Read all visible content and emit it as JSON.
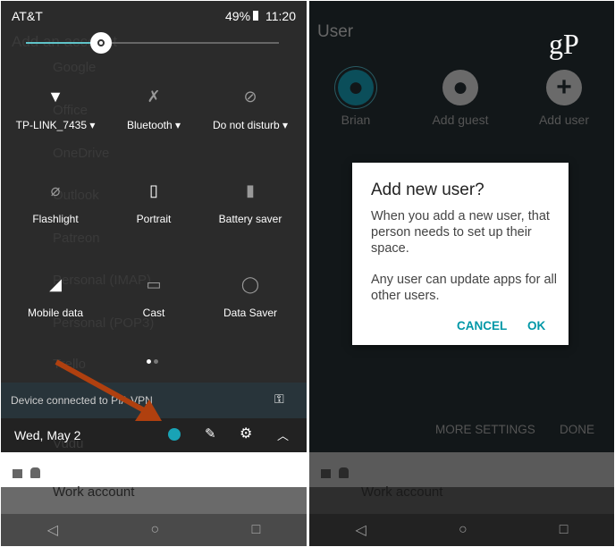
{
  "left": {
    "status": {
      "carrier": "AT&T",
      "battery": "49%",
      "time": "11:20"
    },
    "brightness_level": 0.3,
    "background_list": [
      "Add an account",
      "Google",
      "Office",
      "OneDrive",
      "Outlook",
      "Patreon",
      "Personal (IMAP)",
      "Personal (POP3)",
      "Trello",
      "Vudu",
      "Work account"
    ],
    "tiles": [
      {
        "label": "TP-LINK_7435",
        "icon": "wifi-icon",
        "dropdown": true
      },
      {
        "label": "Bluetooth",
        "icon": "bluetooth-off-icon",
        "dropdown": true
      },
      {
        "label": "Do not disturb",
        "icon": "do-not-disturb-off-icon",
        "dropdown": true
      },
      {
        "label": "Flashlight",
        "icon": "flashlight-off-icon"
      },
      {
        "label": "Portrait",
        "icon": "portrait-icon"
      },
      {
        "label": "Battery saver",
        "icon": "battery-saver-icon"
      },
      {
        "label": "Mobile data",
        "icon": "mobile-data-icon"
      },
      {
        "label": "Cast",
        "icon": "cast-icon"
      },
      {
        "label": "Data Saver",
        "icon": "data-saver-icon"
      }
    ],
    "vpn_text": "Device connected to PIA VPN",
    "date": "Wed, May 2",
    "accent": "#19a3b5",
    "arrow_color": "#b0400f"
  },
  "right": {
    "title": "User",
    "logo": "gP",
    "users": [
      {
        "label": "Brian"
      },
      {
        "label": "Add guest"
      },
      {
        "label": "Add user"
      }
    ],
    "dialog": {
      "title": "Add new user?",
      "body1": "When you add a new user, that person needs to set up their space.",
      "body2": "Any user can update apps for all other users.",
      "cancel": "CANCEL",
      "ok": "OK"
    },
    "more_settings": "MORE SETTINGS",
    "done": "DONE",
    "background_item": "Work account",
    "accent": "#0097a7"
  }
}
